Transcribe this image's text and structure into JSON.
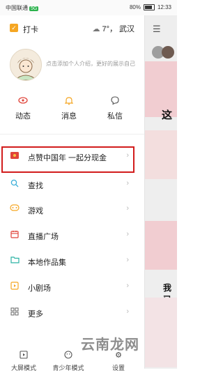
{
  "status_bar": {
    "carrier": "中国联通",
    "carrier_badge": "5G",
    "battery": "80%",
    "time": "12:33"
  },
  "drawer": {
    "checkin_label": "打卡",
    "weather": {
      "temp": "7°，",
      "city": "武汉"
    },
    "profile_hint": "点击添加个人介绍，更好的展示自己",
    "quick_actions": [
      {
        "icon": "eye-icon",
        "label": "动态"
      },
      {
        "icon": "bell-icon",
        "label": "消息"
      },
      {
        "icon": "chat-bubble-icon",
        "label": "私信"
      }
    ],
    "menu_items": [
      {
        "icon": "red-envelope-icon",
        "label": "点赞中国年 一起分现金"
      },
      {
        "icon": "search-icon",
        "label": "查找"
      },
      {
        "icon": "gamepad-icon",
        "label": "游戏"
      },
      {
        "icon": "calendar-icon",
        "label": "直播广场"
      },
      {
        "icon": "folder-icon",
        "label": "本地作品集"
      },
      {
        "icon": "play-icon",
        "label": "小剧场"
      },
      {
        "icon": "grid-icon",
        "label": "更多"
      }
    ],
    "bottom_bar": [
      {
        "icon": "screen-mode-icon",
        "label": "大屏模式"
      },
      {
        "icon": "youth-mode-icon",
        "label": "青少年模式"
      },
      {
        "icon": "settings-icon",
        "label": "设置"
      }
    ]
  },
  "underlay": {
    "chars": [
      "这",
      "我已"
    ]
  },
  "watermark": "云南龙网",
  "colors": {
    "accent_orange": "#f5a623",
    "highlight_red": "#d21c1c",
    "pink": "#f1cdd1"
  }
}
